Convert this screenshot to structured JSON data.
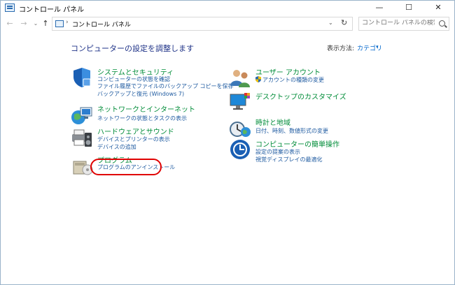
{
  "window": {
    "title": "コントロール パネル",
    "minimize": "—",
    "maximize": "☐",
    "close": "✕"
  },
  "navbar": {
    "back": "←",
    "forward": "→",
    "history": "⌄",
    "up": "↑",
    "address_sep": "›",
    "address": "コントロール パネル",
    "address_drop": "⌄",
    "refresh": "↻",
    "search_placeholder": "コントロール パネルの検索"
  },
  "main": {
    "title": "コンピューターの設定を調整します",
    "view_label": "表示方法:",
    "view_value": "カテゴリ",
    "view_caret": "▾"
  },
  "categories_left": [
    {
      "icon": "shield-icon",
      "title": "システムとセキュリティ",
      "links": [
        "コンピューターの状態を確認",
        "ファイル履歴でファイルのバックアップ コピーを保存",
        "バックアップと復元 (Windows 7)"
      ]
    },
    {
      "icon": "network-globe-icon",
      "title": "ネットワークとインターネット",
      "links": [
        "ネットワークの状態とタスクの表示"
      ]
    },
    {
      "icon": "printer-speaker-icon",
      "title": "ハードウェアとサウンド",
      "links": [
        "デバイスとプリンターの表示",
        "デバイスの追加"
      ]
    },
    {
      "icon": "program-disc-icon",
      "title": "プログラム",
      "links": [
        "プログラムのアンインストール"
      ]
    }
  ],
  "categories_right": [
    {
      "icon": "user-accounts-icon",
      "title": "ユーザー アカウント",
      "links": [
        "アカウントの種類の変更"
      ]
    },
    {
      "icon": "desktop-monitor-icon",
      "title": "デスクトップのカスタマイズ",
      "links": []
    },
    {
      "icon": "clock-globe-icon",
      "title": "時計と地域",
      "links": [
        "日付、時刻、数値形式の変更"
      ]
    },
    {
      "icon": "ease-of-access-icon",
      "title": "コンピューターの簡単操作",
      "links": [
        "設定の提案の表示",
        "視覚ディスプレイの最適化"
      ]
    }
  ],
  "colors": {
    "heading": "#1e3287",
    "category": "#008c38",
    "link": "#1e5aa0",
    "highlight": "#e00000"
  }
}
